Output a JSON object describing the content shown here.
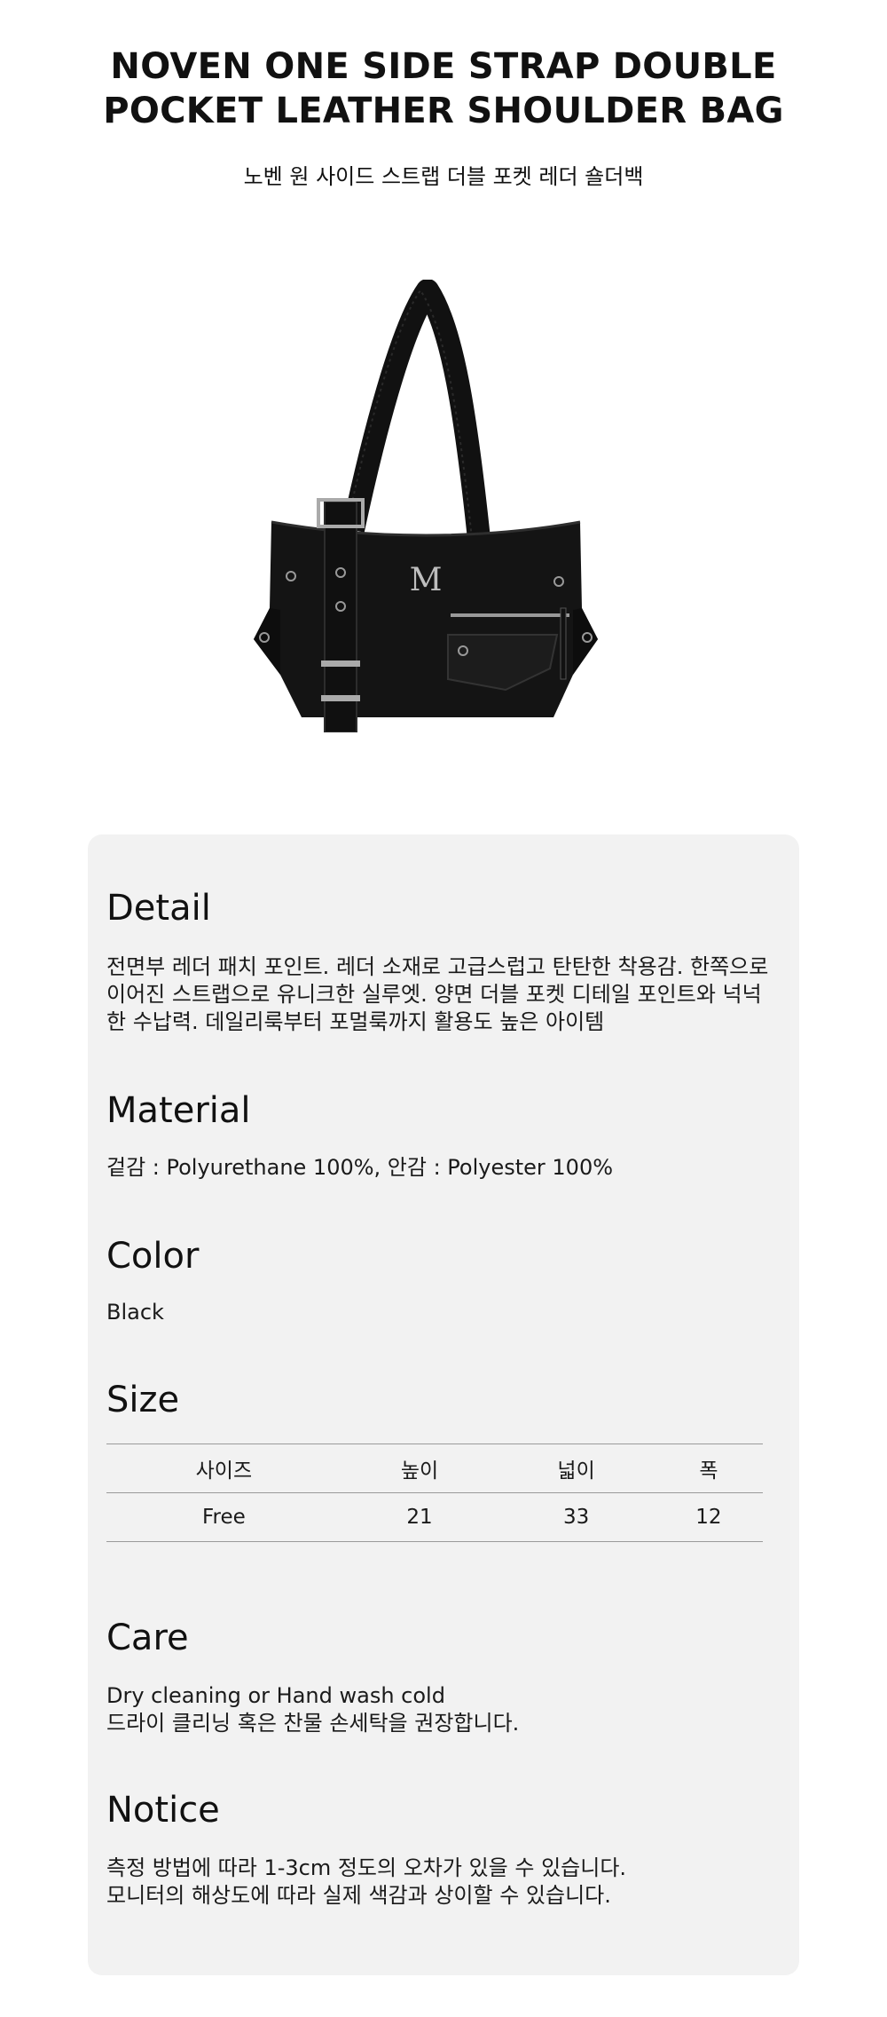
{
  "product": {
    "title_line1": "NOVEN ONE SIDE STRAP DOUBLE",
    "title_line2": "POCKET LEATHER SHOULDER BAG",
    "subtitle_ko": "노벤 원 사이드 스트랩 더블 포켓 레더 숄더백",
    "image_logo": "M"
  },
  "colors": {
    "card_background": "#f2f2f2",
    "bag": "#141414"
  },
  "detail": {
    "title": "Detail",
    "lines": [
      "전면부 레더 패치 포인트. 레더 소재로 고급스럽고 탄탄한 착용감. 한쪽으로",
      "이어진 스트랩으로 유니크한 실루엣. 양면 더블 포켓 디테일 포인트와 넉넉",
      "한 수납력. 데일리룩부터 포멀룩까지 활용도 높은 아이템"
    ]
  },
  "material": {
    "title": "Material",
    "text": "겉감 : Polyurethane 100%, 안감 : Polyester 100%"
  },
  "color": {
    "title": "Color",
    "text": "Black"
  },
  "size": {
    "title": "Size",
    "headers": [
      "사이즈",
      "높이",
      "넓이",
      "폭"
    ],
    "rows": [
      [
        "Free",
        "21",
        "33",
        "12"
      ]
    ]
  },
  "care": {
    "title": "Care",
    "lines": [
      "Dry cleaning or Hand wash cold",
      "드라이 클리닝 혹은 찬물 손세탁을 권장합니다."
    ]
  },
  "notice": {
    "title": "Notice",
    "lines": [
      "측정 방법에 따라 1-3cm 정도의 오차가 있을 수 있습니다.",
      "모니터의 해상도에 따라 실제 색감과 상이할 수 있습니다."
    ]
  }
}
